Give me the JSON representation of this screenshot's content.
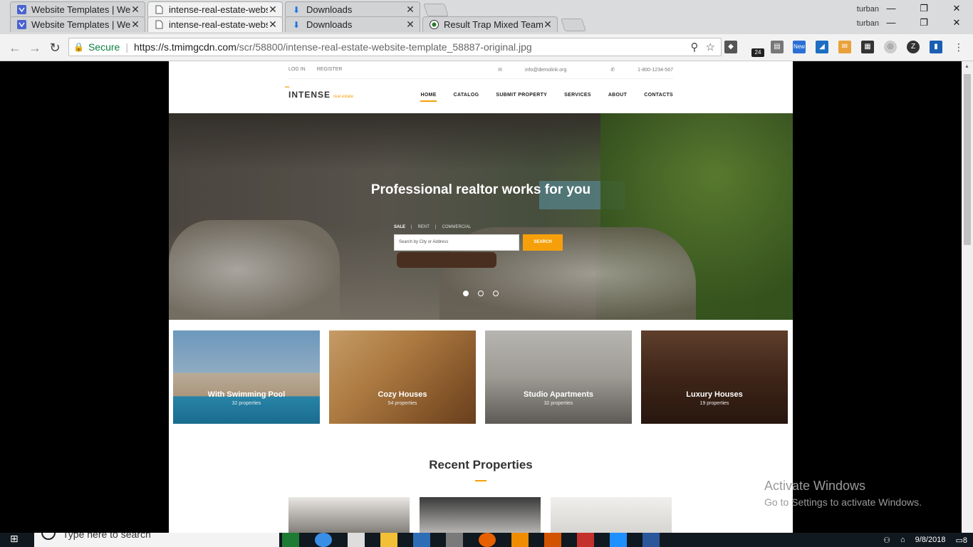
{
  "browser": {
    "tabs_row1": [
      {
        "title": "Website Templates | Web",
        "icon": "template-monster-icon"
      },
      {
        "title": "intense-real-estate-websi",
        "icon": "page-icon"
      },
      {
        "title": "Downloads",
        "icon": "download-icon"
      }
    ],
    "tabs_row2": [
      {
        "title": "Website Templates | Web",
        "icon": "template-monster-icon"
      },
      {
        "title": "intense-real-estate-websi",
        "icon": "page-icon"
      },
      {
        "title": "Downloads",
        "icon": "download-icon"
      },
      {
        "title": "Result Trap Mixed Team J",
        "icon": "circle-target-icon"
      }
    ],
    "user": "turban",
    "secure_label": "Secure",
    "url_host": "https://s.tmimgcdn.com",
    "url_path": "/scr/58800/intense-real-estate-website-template_58887-original.jpg",
    "ext_badges": {
      "count": "24",
      "new": "New"
    }
  },
  "site": {
    "topbar": {
      "login": "LOG IN",
      "register": "REGISTER",
      "email": "info@demolink.org",
      "phone": "1-800-1234-567"
    },
    "logo": {
      "name": "INTENSE",
      "tagline": "real estate"
    },
    "menu": [
      "HOME",
      "CATALOG",
      "SUBMIT PROPERTY",
      "SERVICES",
      "ABOUT",
      "CONTACTS"
    ],
    "hero": {
      "title": "Professional realtor works for you",
      "tabs": [
        "SALE",
        "RENT",
        "COMMERCIAL"
      ],
      "search_placeholder": "Search by City or Address",
      "search_button": "SEARCH"
    },
    "categories": [
      {
        "title": "With Swimming Pool",
        "count": "32 properties"
      },
      {
        "title": "Cozy Houses",
        "count": "54 properties"
      },
      {
        "title": "Studio Apartments",
        "count": "32 properties"
      },
      {
        "title": "Luxury Houses",
        "count": "19 properties"
      }
    ],
    "recent_title": "Recent Properties"
  },
  "watermark": {
    "line1": "Activate Windows",
    "line2": "Go to Settings to activate Windows."
  },
  "taskbar": {
    "search_placeholder": "Type here to search",
    "date": "9/8/2018",
    "notif_count": "8"
  }
}
